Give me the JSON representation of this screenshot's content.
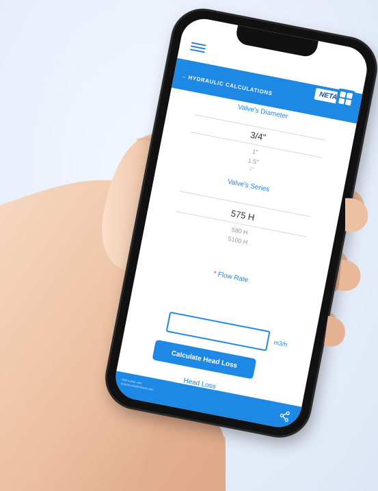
{
  "app": {
    "header_title": "→ HYDRAULIC CALCULATIONS",
    "brand": "NETAFIM"
  },
  "valve_diameter": {
    "label": "Valve's Diameter",
    "selected": "3/4\"",
    "options": [
      "1\"",
      "1.5\"",
      "2\""
    ]
  },
  "valve_series": {
    "label": "Valve's Series",
    "selected": "575 H",
    "options": [
      "580 H",
      "5100 H"
    ]
  },
  "flow_rate": {
    "required_mark": "*",
    "label": "Flow Rate",
    "value": "",
    "unit": "m3/h"
  },
  "calculate_button": "Calculate Head Loss",
  "result_label": "Head Loss",
  "footer": {
    "line1": "Start a plan, visit",
    "line2": "projects.netafimtorture.com"
  },
  "colors": {
    "primary": "#1e88e5",
    "background": "#e7eefa",
    "skin": "#f1c9ad",
    "phone": "#111111"
  },
  "icons": [
    "hamburger-menu-icon",
    "calculator-icon",
    "share-icon",
    "netafim-logo"
  ]
}
